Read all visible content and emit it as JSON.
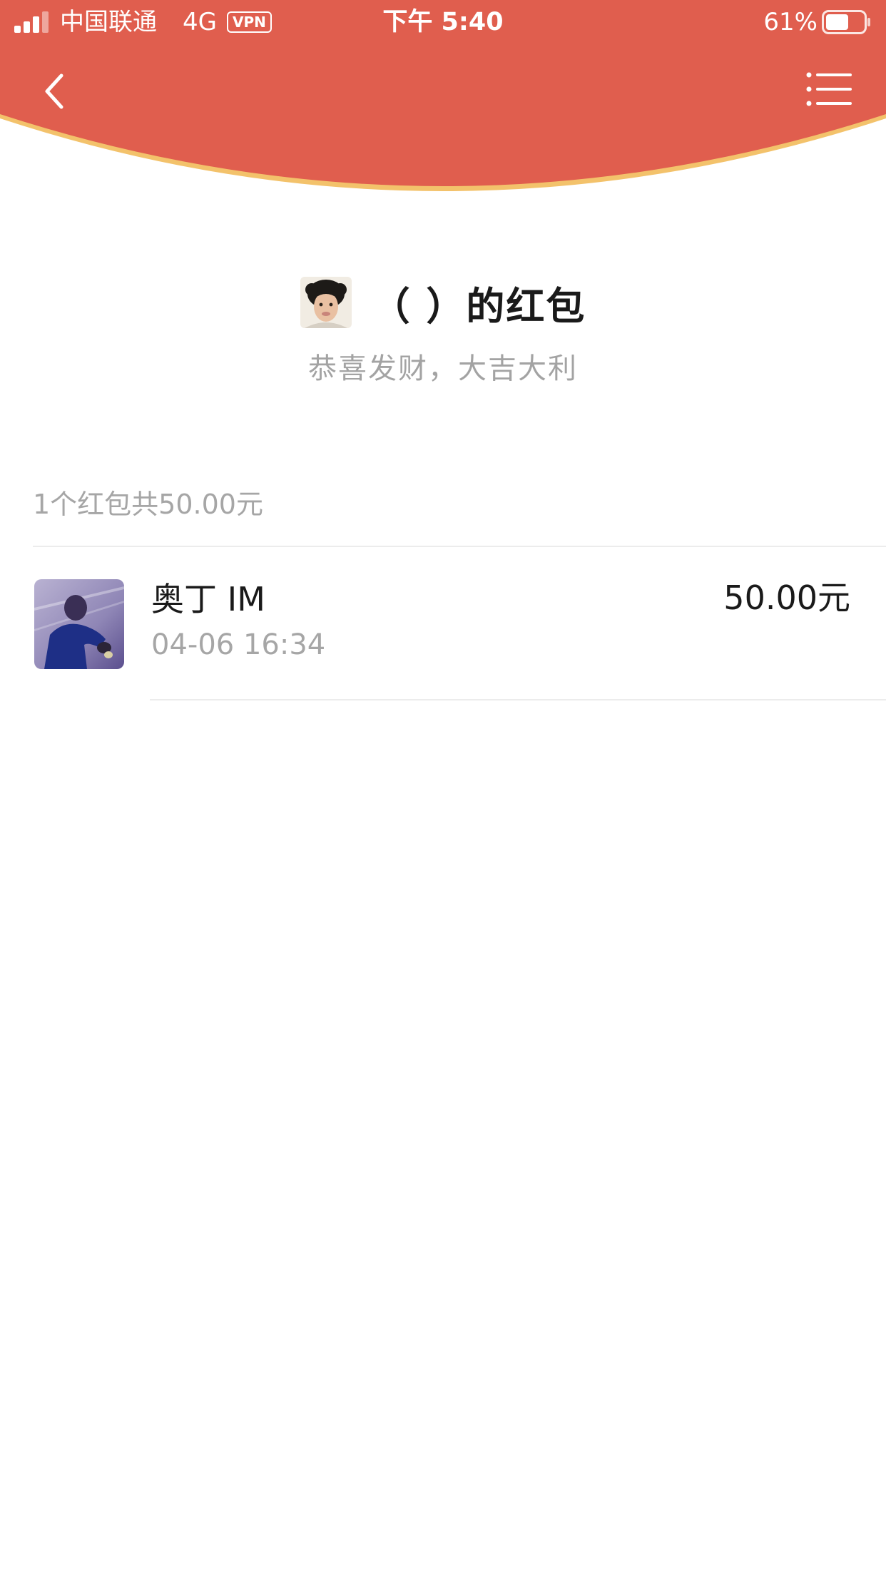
{
  "status_bar": {
    "carrier": "中国联通",
    "network": "4G",
    "vpn": "VPN",
    "time": "下午 5:40",
    "battery_percent": "61%",
    "battery_level": 0.61
  },
  "nav": {
    "back_icon": "chevron-left-icon",
    "menu_icon": "list-menu-icon"
  },
  "envelope": {
    "title": "（ ）的红包",
    "blessing": "恭喜发财，大吉大利"
  },
  "summary": "1个红包共50.00元",
  "receivers": [
    {
      "name": "奥丁 IM",
      "time": "04-06 16:34",
      "amount": "50.00元"
    }
  ],
  "colors": {
    "header_red": "#e05e4e",
    "header_edge_gold": "#f3c26b",
    "text_dark": "#1a1a1a",
    "text_gray": "#a6a6a6"
  }
}
